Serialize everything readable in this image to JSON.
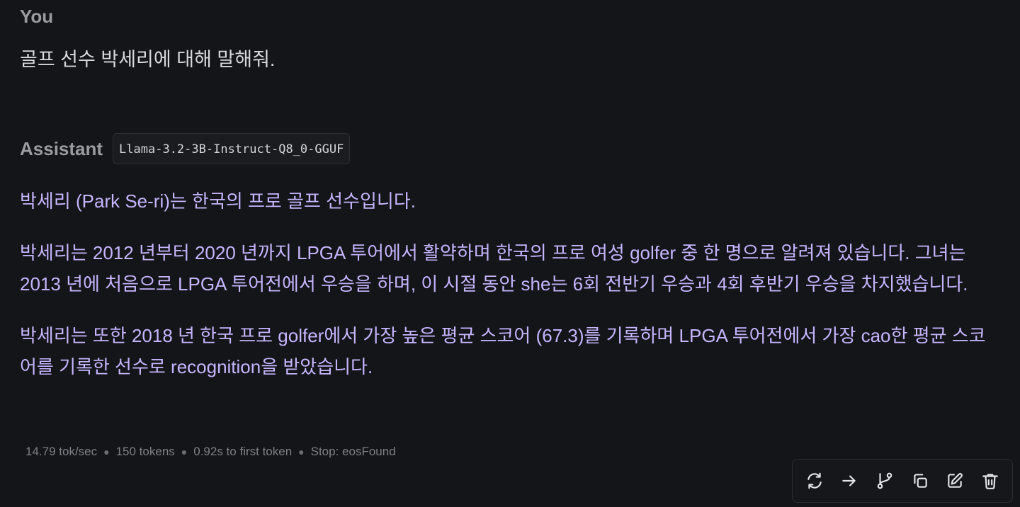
{
  "user": {
    "role": "You",
    "message": "골프 선수 박세리에 대해 말해줘."
  },
  "assistant": {
    "role": "Assistant",
    "model": "Llama-3.2-3B-Instruct-Q8_0-GGUF",
    "paragraphs": [
      "박세리 (Park Se-ri)는 한국의 프로 골프 선수입니다.",
      "박세리는 2012 년부터 2020 년까지 LPGA 투어에서 활약하며 한국의 프로 여성 golfer 중 한 명으로 알려져 있습니다. 그녀는 2013 년에 처음으로 LPGA 투어전에서 우승을 하며, 이 시절 동안 she는 6회 전반기 우승과 4회 후반기 우승을 차지했습니다.",
      "박세리는 또한 2018 년 한국 프로 golfer에서 가장 높은 평균 스코어 (67.3)를 기록하며 LPGA 투어전에서 가장 cao한 평균 스코어를 기록한 선수로 recognition을 받았습니다."
    ],
    "stats": {
      "speed": "14.79 tok/sec",
      "tokens": "150 tokens",
      "first_token": "0.92s to first token",
      "stop": "Stop: eosFound"
    }
  },
  "toolbar": {
    "icons": [
      "regenerate-icon",
      "continue-icon",
      "branch-icon",
      "copy-icon",
      "edit-icon",
      "delete-icon"
    ]
  },
  "colors": {
    "background": "#131518",
    "response_text": "#c7b5ff",
    "role_text": "#9a9ca1"
  }
}
